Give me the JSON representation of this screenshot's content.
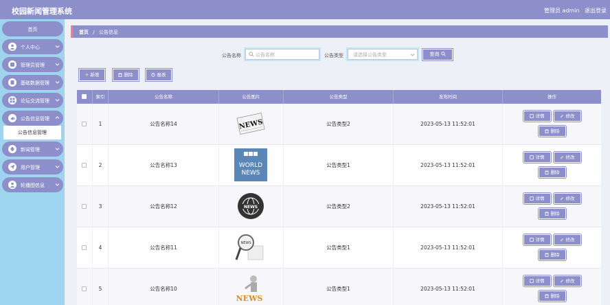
{
  "header": {
    "title": "校园新闻管理系统",
    "user": "管理员 admin",
    "logout": "退出登录"
  },
  "sidebar": {
    "items": [
      {
        "label": "首页",
        "icon": "home"
      },
      {
        "label": "个人中心",
        "icon": "user-icon"
      },
      {
        "label": "管理员管理",
        "icon": "admin-icon"
      },
      {
        "label": "基础数据管理",
        "icon": "database-icon"
      },
      {
        "label": "论坛交流管理",
        "icon": "forum-icon"
      },
      {
        "label": "公告信息管理",
        "icon": "notice-icon"
      },
      {
        "label": "新闻管理",
        "icon": "news-icon"
      },
      {
        "label": "用户管理",
        "icon": "users-icon"
      },
      {
        "label": "轮播图信息",
        "icon": "carousel-icon"
      }
    ],
    "sub_item": "公告信息管理"
  },
  "breadcrumb": {
    "home": "首页",
    "sep": "/",
    "current": "公告信息"
  },
  "search": {
    "name_label": "公告名称",
    "name_placeholder": "公告名称",
    "type_label": "公告类型",
    "type_placeholder": "请选择公告类型",
    "query": "查询"
  },
  "actions": {
    "add": "+ 新增",
    "delete": "删除",
    "report": "报表"
  },
  "table": {
    "headers": [
      "",
      "索引",
      "公告名称",
      "公告图片",
      "公告类型",
      "发布时间",
      "操作"
    ],
    "ops": {
      "detail": "详情",
      "edit": "修改",
      "delete": "删除"
    },
    "rows": [
      {
        "index": "1",
        "name": "公告名称14",
        "image": "news-newspaper-icon",
        "type": "公告类型2",
        "time": "2023-05-13 11:52:01"
      },
      {
        "index": "2",
        "name": "公告名称13",
        "image": "bbc-world-news-icon",
        "type": "公告类型1",
        "time": "2023-05-13 11:52:01"
      },
      {
        "index": "3",
        "name": "公告名称12",
        "image": "news-globe-icon",
        "type": "公告类型2",
        "time": "2023-05-13 11:52:01"
      },
      {
        "index": "4",
        "name": "公告名称11",
        "image": "news-magnifier-icon",
        "type": "公告类型1",
        "time": "2023-05-13 11:52:01"
      },
      {
        "index": "5",
        "name": "公告名称10",
        "image": "news-figure-icon",
        "type": "公告类型1",
        "time": "2023-05-13 11:52:01"
      }
    ]
  },
  "colors": {
    "primary": "#8c8fc9",
    "sidebar": "#9fd4ee",
    "accent": "#ff7b7b"
  }
}
